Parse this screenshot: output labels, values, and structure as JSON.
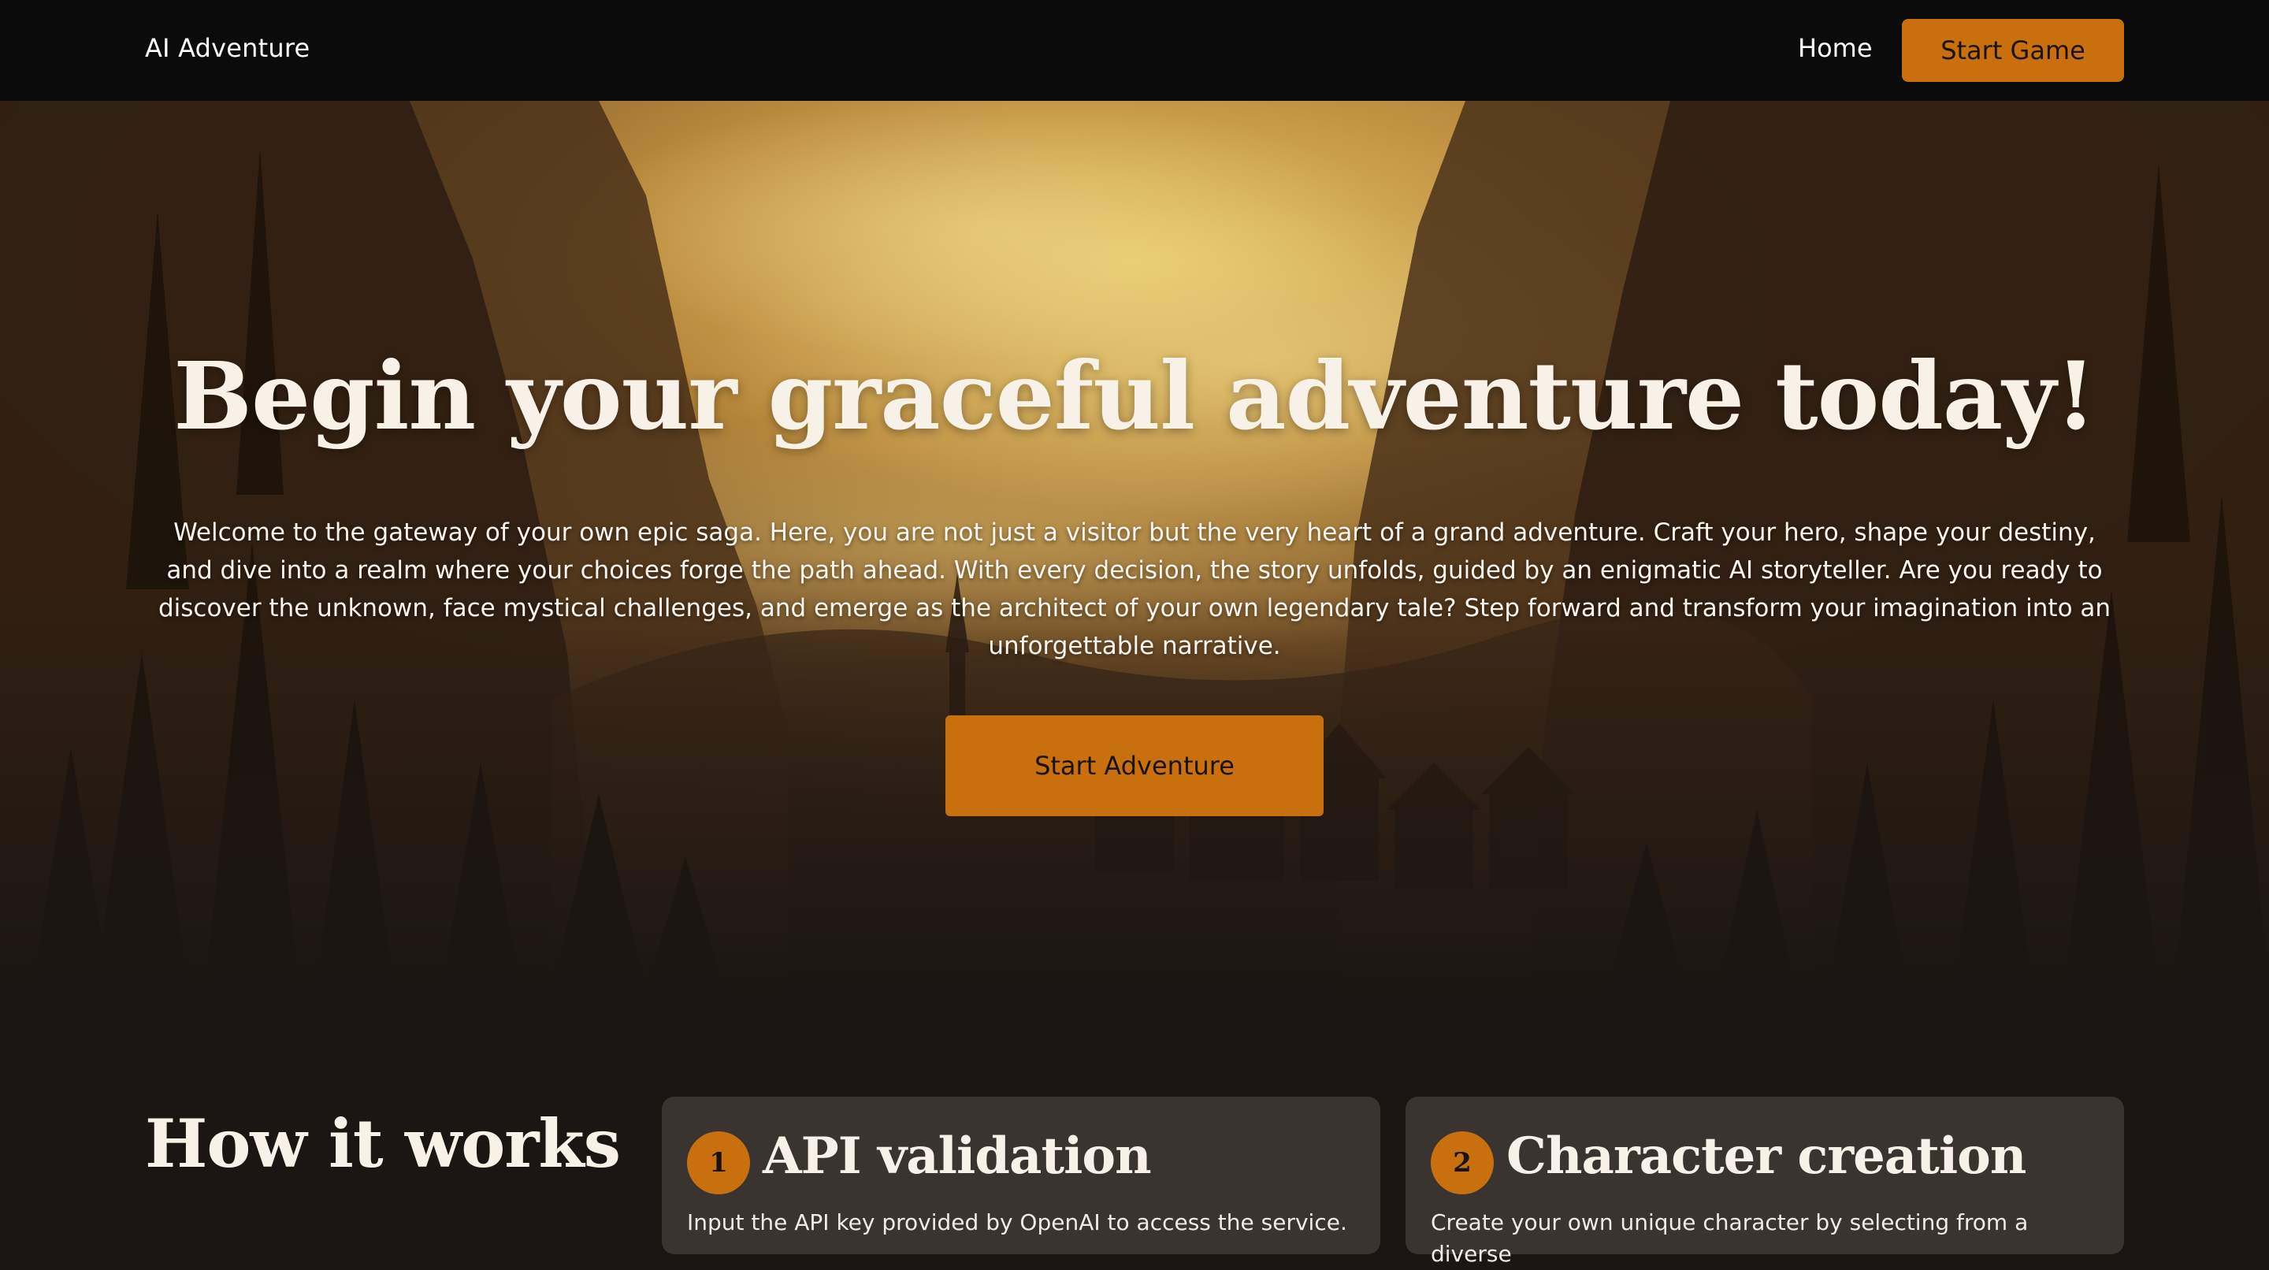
{
  "navbar": {
    "brand": "AI Adventure",
    "home_label": "Home",
    "cta_label": "Start Game"
  },
  "hero": {
    "title": "Begin your graceful adventure today!",
    "description": "Welcome to the gateway of your own epic saga. Here, you are not just a visitor but the very heart of a grand adventure. Craft your hero, shape your destiny, and dive into a realm where your choices forge the path ahead. With every decision, the story unfolds, guided by an enigmatic AI storyteller. Are you ready to discover the unknown, face mystical challenges, and emerge as the architect of your own legendary tale? Step forward and transform your imagination into an unforgettable narrative.",
    "cta_label": "Start Adventure",
    "background_image": "misty-forest-valley-village-illustration"
  },
  "how_it_works": {
    "title": "How it works",
    "steps": [
      {
        "number": "1",
        "title": "API validation",
        "text": "Input the API key provided by OpenAI to access the service."
      },
      {
        "number": "2",
        "title": "Character creation",
        "text": "Create your own unique character by selecting from a diverse"
      }
    ]
  },
  "colors": {
    "accent": "#c8700e",
    "navbar_bg": "#0b0b0b",
    "page_bg": "#1b1613",
    "card_bg": "#3a3431",
    "text": "#f7f1e8"
  }
}
